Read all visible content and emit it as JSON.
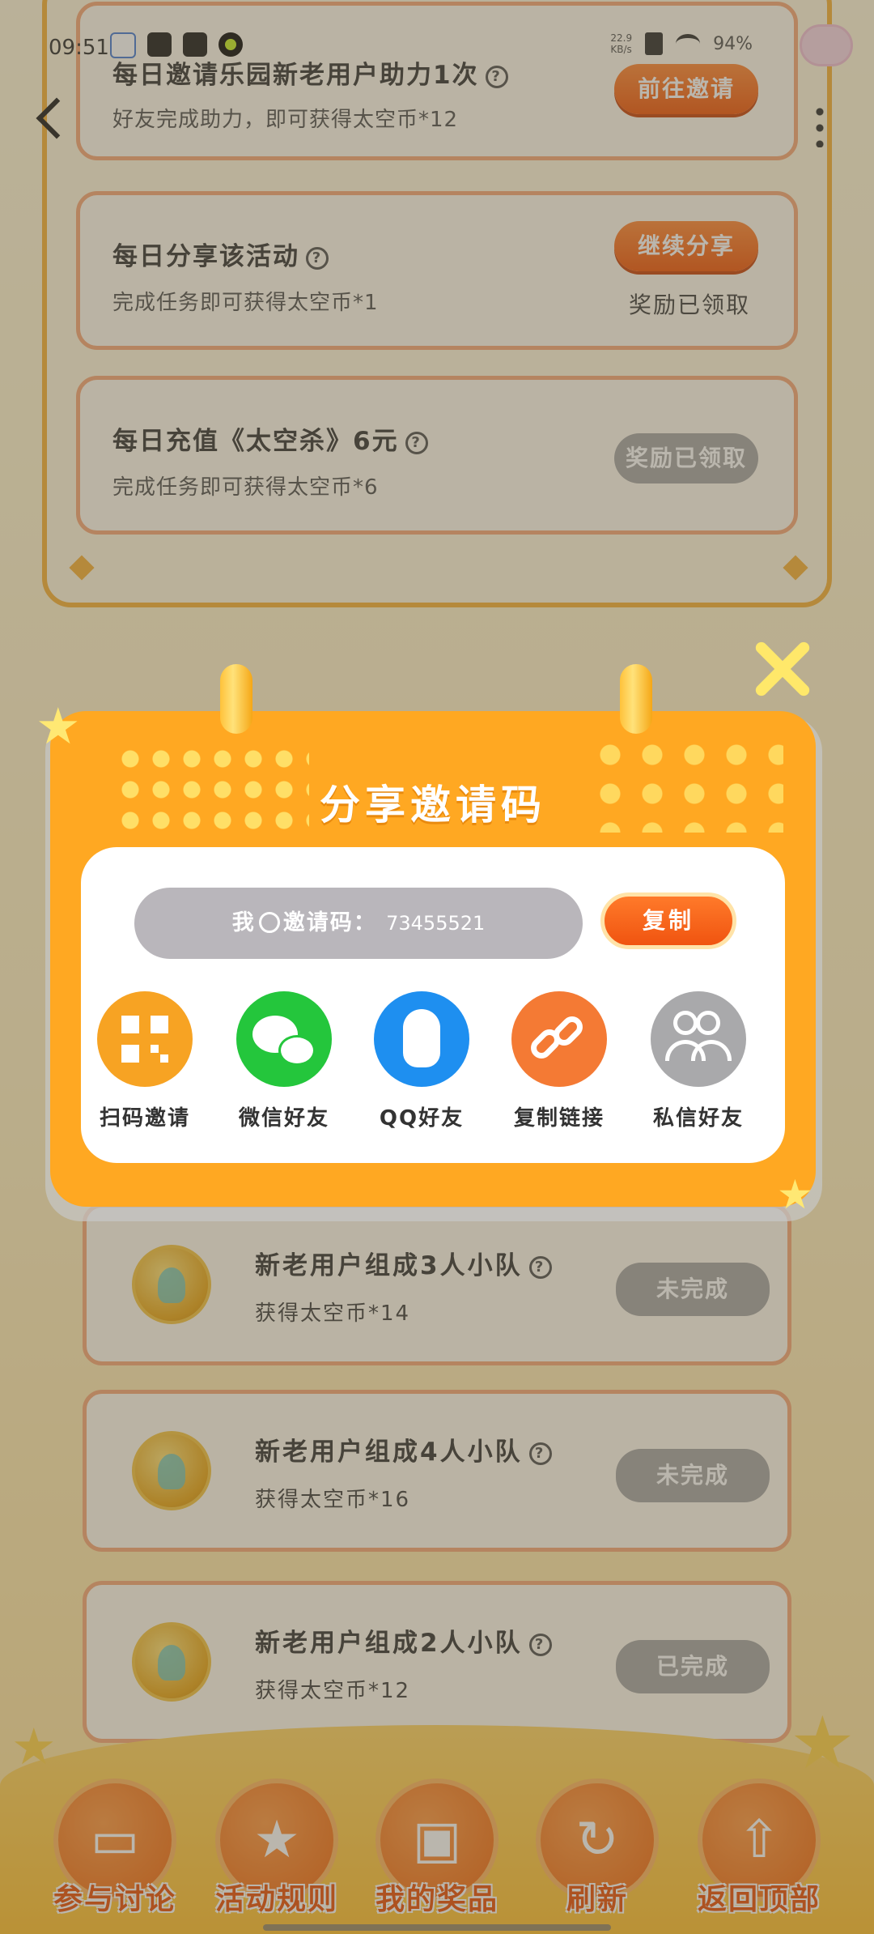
{
  "status_bar": {
    "time": "09:51",
    "network_speed": "22.9\nKB/s",
    "battery": "94%"
  },
  "tasks_top": [
    {
      "title": "每日邀请乐园新老用户助力1次",
      "subtitle": "好友完成助力，即可获得太空币*12",
      "button": "前往邀请",
      "button_state": "active",
      "note": ""
    },
    {
      "title": "每日分享该活动",
      "subtitle": "完成任务即可获得太空币*1",
      "button": "继续分享",
      "button_state": "active",
      "note": "奖励已领取"
    },
    {
      "title": "每日充值《太空杀》6元",
      "subtitle": "完成任务即可获得太空币*6",
      "button": "奖励已领取",
      "button_state": "disabled",
      "note": ""
    }
  ],
  "team_tasks": [
    {
      "title": "新老用户组成3人小队",
      "subtitle": "获得太空币*14",
      "button": "未完成"
    },
    {
      "title": "新老用户组成4人小队",
      "subtitle": "获得太空币*16",
      "button": "未完成"
    },
    {
      "title": "新老用户组成2人小队",
      "subtitle": "获得太空币*12",
      "button": "已完成"
    }
  ],
  "bottom_nav": [
    {
      "label": "参与讨论",
      "icon": "chat-icon"
    },
    {
      "label": "活动规则",
      "icon": "star-rules-icon"
    },
    {
      "label": "我的奖品",
      "icon": "gift-icon"
    },
    {
      "label": "刷新",
      "icon": "refresh-icon"
    },
    {
      "label": "返回顶部",
      "icon": "upload-top-icon"
    }
  ],
  "modal": {
    "title": "分享邀请码",
    "code_label": "我",
    "code_label_rest": "邀请码：",
    "code_value": "73455521",
    "copy_label": "复制",
    "share_options": [
      {
        "label": "扫码邀请",
        "icon": "qrcode-icon",
        "color": "#f7a323"
      },
      {
        "label": "微信好友",
        "icon": "wechat-icon",
        "color": "#24c63c"
      },
      {
        "label": "QQ好友",
        "icon": "qq-icon",
        "color": "#1e8ff0"
      },
      {
        "label": "复制链接",
        "icon": "link-icon",
        "color": "#f47a34"
      },
      {
        "label": "私信好友",
        "icon": "people-icon",
        "color": "#a9a9ab"
      }
    ]
  },
  "colors": {
    "accent_orange": "#f05a10",
    "modal_orange": "#ffa822",
    "disabled_gray": "#a8a8a8"
  }
}
